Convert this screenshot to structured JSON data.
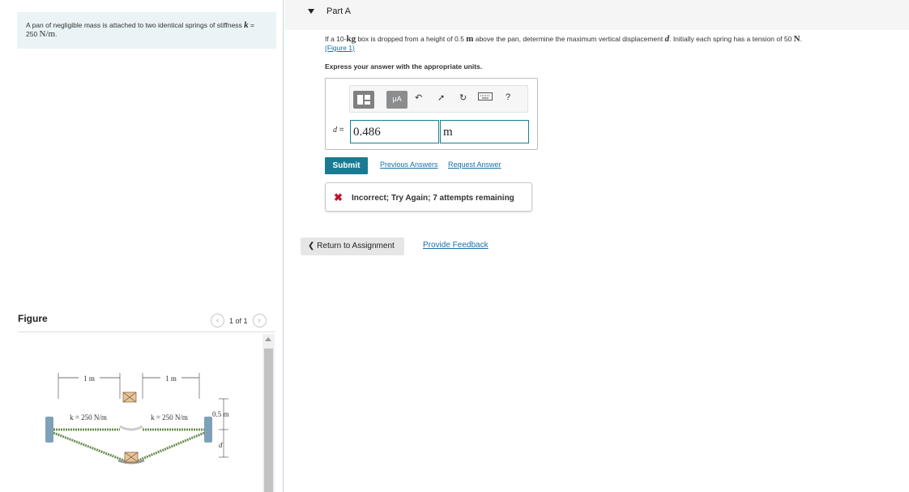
{
  "problem": {
    "text_part1": "A pan of negligible mass is attached to two identical springs of stiffness ",
    "k_symbol": "k",
    "text_part2": " = 250 ",
    "unit": "N/m",
    "period": "."
  },
  "figure": {
    "label": "Figure",
    "pager": "1 of 1",
    "prev_icon": "chevron-left-icon",
    "next_icon": "chevron-right-icon",
    "dim_left": "1 m",
    "dim_right": "1 m",
    "spring_left": "k = 250 N/m",
    "spring_right": "k = 250 N/m",
    "height": "0.5 m",
    "disp": "d"
  },
  "part": {
    "title": "Part A"
  },
  "question": {
    "t1": "If a 10-",
    "kg": "kg",
    "t2": " box is dropped from a height of 0.5 ",
    "m": "m",
    "t3": " above the pan, determine the maximum vertical displacement ",
    "d": "d",
    "t4": ". Initially each spring has a tension of 50 ",
    "N": "N",
    "t5": ".",
    "figure_link": "(Figure 1)",
    "express": "Express your answer with the appropriate units."
  },
  "toolbar": {
    "units_label": "μA",
    "undo_icon": "undo-icon",
    "redo_icon": "redo-icon",
    "reset_icon": "reset-icon",
    "keyboard_icon": "keyboard-icon",
    "help_label": "?"
  },
  "answer": {
    "var_label": "d",
    "eq": " =",
    "value": "0.486",
    "unit": "m"
  },
  "actions": {
    "submit": "Submit",
    "previous_answers": "Previous Answers",
    "request_answer": "Request Answer"
  },
  "feedback": {
    "icon": "✖",
    "message": "Incorrect; Try Again; 7 attempts remaining"
  },
  "footer": {
    "return_label": "Return to Assignment",
    "provide_feedback": "Provide Feedback"
  }
}
